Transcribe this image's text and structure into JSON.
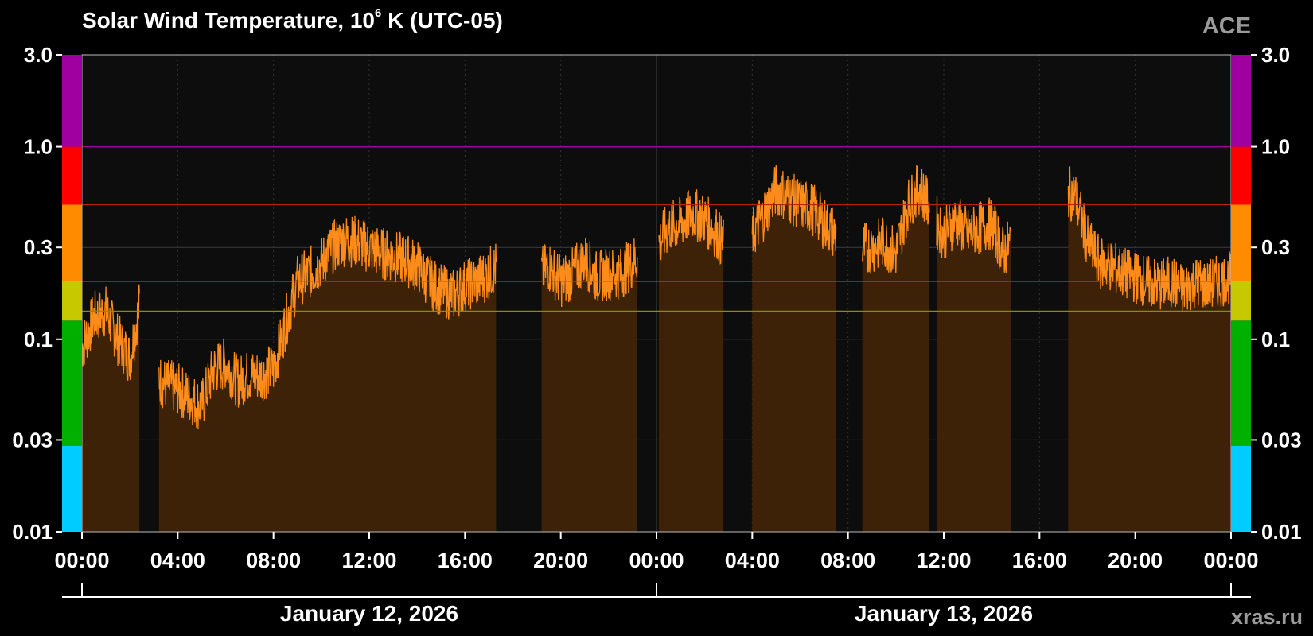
{
  "header": {
    "title_main": "Solar Wind Temperature, 10",
    "title_exponent": "6",
    "title_suffix": " K (UTC-05)",
    "source": "ACE",
    "watermark": "xras.ru"
  },
  "colors": {
    "background": "#000000",
    "plot_background": "#0d0d0d",
    "series": "#ff8c1a",
    "fill": "#3d2208",
    "scale_bands": [
      "#00ccff",
      "#00b000",
      "#c8c800",
      "#ff8c00",
      "#ff0000",
      "#a000a0"
    ]
  },
  "chart_data": {
    "type": "area",
    "yscale": "log",
    "ylim": [
      0.01,
      3.0
    ],
    "yticks": [
      "0.01",
      "0.03",
      "0.1",
      "0.3",
      "1.0",
      "3.0"
    ],
    "ytick_values": [
      0.01,
      0.03,
      0.1,
      0.3,
      1.0,
      3.0
    ],
    "xlim_hours": [
      0,
      48
    ],
    "xticks": [
      "00:00",
      "04:00",
      "08:00",
      "12:00",
      "16:00",
      "20:00",
      "00:00",
      "04:00",
      "08:00",
      "12:00",
      "16:00",
      "20:00",
      "00:00"
    ],
    "dates": [
      "January 12, 2026",
      "January 13, 2026"
    ],
    "threshold_lines": [
      {
        "value": 1.0,
        "color": "#a000a0"
      },
      {
        "value": 0.5,
        "color": "#b32400"
      },
      {
        "value": 0.2,
        "color": "#b36200"
      },
      {
        "value": 0.14,
        "color": "#8c8c00"
      }
    ],
    "scale_band_edges": [
      0.01,
      0.028,
      0.125,
      0.2,
      0.5,
      1.0,
      3.0
    ],
    "series": [
      {
        "hours": [
          0,
          0.5,
          1,
          1.5,
          2,
          2.4,
          3.3,
          4,
          4.5,
          5,
          5.5,
          6,
          6.5,
          7,
          7.5,
          8,
          8.5,
          9,
          9.5,
          10,
          10.5,
          11,
          11.5,
          12,
          12.5,
          13,
          13.5,
          14,
          14.5,
          15,
          15.5,
          16,
          16.5,
          17,
          17.5,
          18,
          18.5,
          19,
          19.5,
          20,
          20.5,
          21,
          21.5,
          22,
          22.5,
          23,
          23.5,
          24,
          24.5,
          25,
          25.5,
          26,
          26.5,
          27,
          27.5,
          28,
          28.5,
          29,
          29.5,
          30,
          30.5,
          31,
          31.5,
          32,
          32.5,
          33,
          33.5,
          34,
          34.5,
          35,
          35.5,
          36,
          36.5,
          37,
          37.5,
          38,
          38.5,
          39,
          39.5,
          40,
          40.5,
          41,
          41.5,
          42,
          42.5,
          43,
          43.5,
          44,
          44.5,
          45,
          45.5,
          46,
          46.5,
          47,
          47.5,
          48
        ],
        "values": [
          0.09,
          0.13,
          0.14,
          0.1,
          0.08,
          0.15,
          0.06,
          0.055,
          0.05,
          0.045,
          0.07,
          0.075,
          0.06,
          0.065,
          0.065,
          0.07,
          0.12,
          0.2,
          0.22,
          0.25,
          0.3,
          0.33,
          0.32,
          0.3,
          0.28,
          0.27,
          0.26,
          0.24,
          0.2,
          0.18,
          0.17,
          0.19,
          0.2,
          0.22,
          0.25,
          0.23,
          0.27,
          0.21,
          0.24,
          0.2,
          0.22,
          0.26,
          0.21,
          0.22,
          0.22,
          0.25,
          0.3,
          0.3,
          0.38,
          0.4,
          0.45,
          0.42,
          0.36,
          0.28,
          0.3,
          0.35,
          0.45,
          0.6,
          0.55,
          0.5,
          0.48,
          0.4,
          0.35,
          0.38,
          0.3,
          0.3,
          0.32,
          0.28,
          0.5,
          0.62,
          0.45,
          0.35,
          0.42,
          0.35,
          0.38,
          0.4,
          0.28,
          0.35,
          0.45,
          0.5,
          0.4,
          0.6,
          0.55,
          0.32,
          0.25,
          0.24,
          0.22,
          0.21,
          0.2,
          0.19,
          0.2,
          0.18,
          0.2,
          0.19,
          0.2,
          0.21
        ]
      }
    ],
    "gaps_hours": [
      [
        2.4,
        3.2
      ],
      [
        17.3,
        19.2
      ],
      [
        23.2,
        24.1
      ],
      [
        26.8,
        28.0
      ],
      [
        31.5,
        32.6
      ],
      [
        35.4,
        35.7
      ],
      [
        38.8,
        41.2
      ]
    ]
  }
}
